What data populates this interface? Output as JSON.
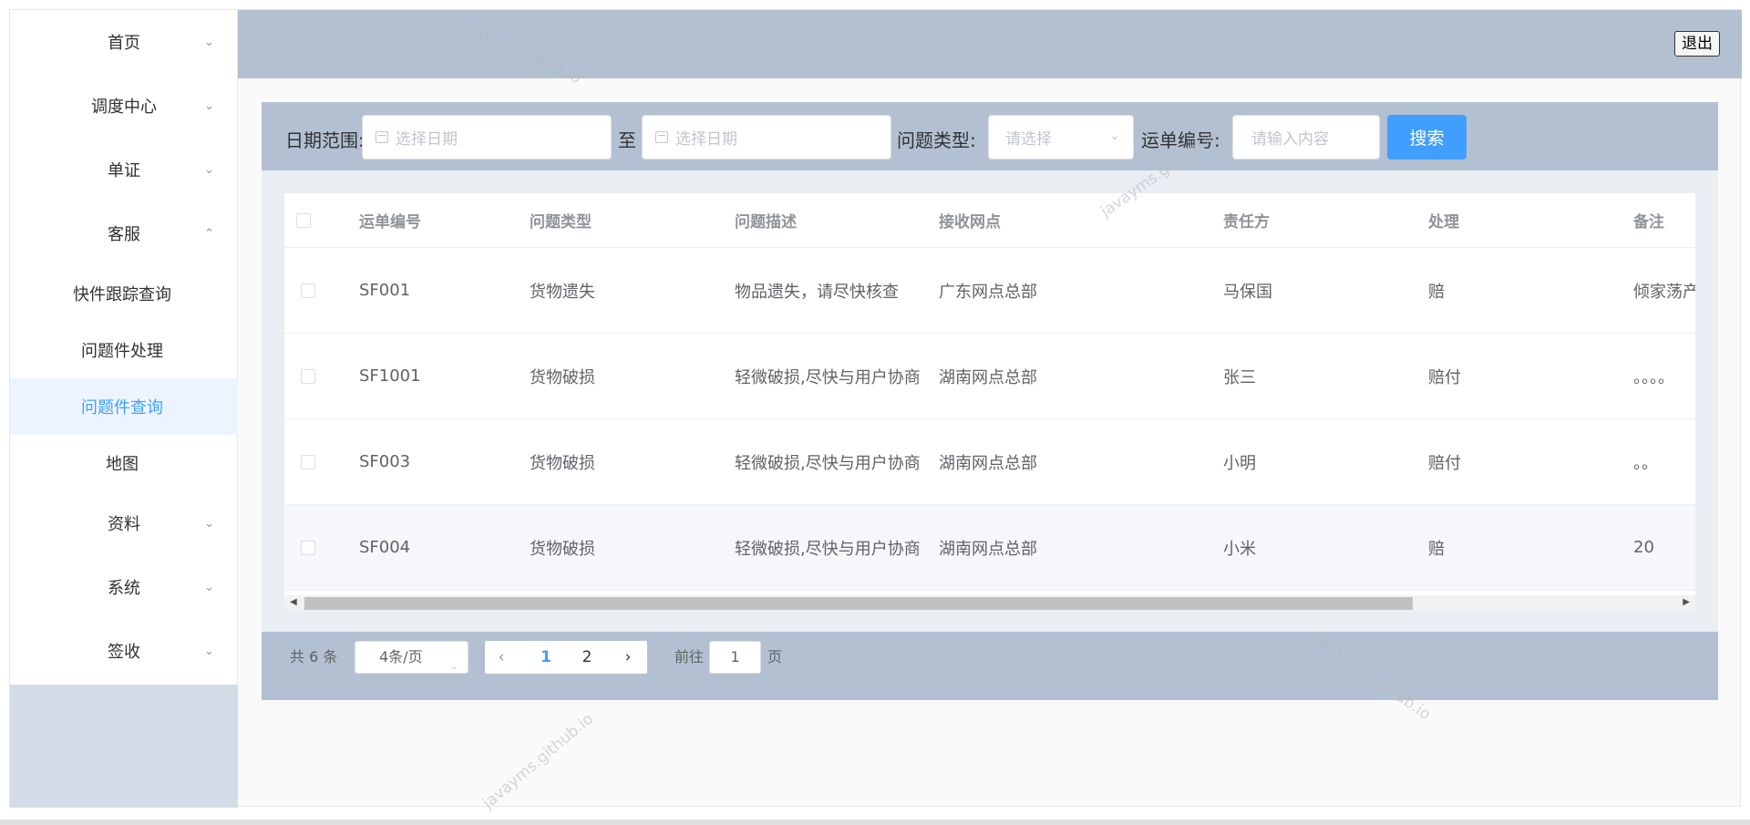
{
  "sidebar": {
    "items": [
      {
        "label": "首页",
        "arrow": "⌄"
      },
      {
        "label": "调度中心",
        "arrow": "⌄"
      },
      {
        "label": "单证",
        "arrow": "⌄"
      },
      {
        "label": "客服",
        "arrow": "⌃"
      },
      {
        "label": "快件跟踪查询"
      },
      {
        "label": "问题件处理"
      },
      {
        "label": "问题件查询"
      },
      {
        "label": "地图"
      },
      {
        "label": "资料",
        "arrow": "⌄"
      },
      {
        "label": "系统",
        "arrow": "⌄"
      },
      {
        "label": "签收",
        "arrow": "⌄"
      }
    ]
  },
  "header": {
    "logout_label": "退出"
  },
  "search": {
    "date_label": "日期范围:",
    "date_placeholder": "选择日期",
    "to_label": "至",
    "type_label": "问题类型:",
    "type_placeholder": "请选择",
    "waybill_label": "运单编号:",
    "waybill_placeholder": "请输入内容",
    "search_label": "搜索"
  },
  "table": {
    "columns": [
      "运单编号",
      "问题类型",
      "问题描述",
      "接收网点",
      "责任方",
      "处理",
      "备注"
    ],
    "rows": [
      [
        "SF001",
        "货物遗失",
        "物品遗失，请尽快核查",
        "广东网点总部",
        "马保国",
        "赔",
        "倾家荡产"
      ],
      [
        "SF1001",
        "货物破损",
        "轻微破损,尽快与用户协商",
        "湖南网点总部",
        "张三",
        "赔付",
        "。。。。"
      ],
      [
        "SF003",
        "货物破损",
        "轻微破损,尽快与用户协商",
        "湖南网点总部",
        "小明",
        "赔付",
        "。。"
      ],
      [
        "SF004",
        "货物破损",
        "轻微破损,尽快与用户协商",
        "湖南网点总部",
        "小米",
        "赔",
        "20"
      ]
    ]
  },
  "pager": {
    "total": "共 6 条",
    "page_size": "4条/页",
    "prev": "‹",
    "pages": [
      "1",
      "2"
    ],
    "next": "›",
    "goto_label": "前往",
    "goto_value": "1",
    "page_unit": "页"
  },
  "watermark": "javayms.github.io",
  "colors": {
    "accent": "#409eff",
    "header_bg": "#b3c0d1",
    "active_bg": "#ecf5ff"
  }
}
